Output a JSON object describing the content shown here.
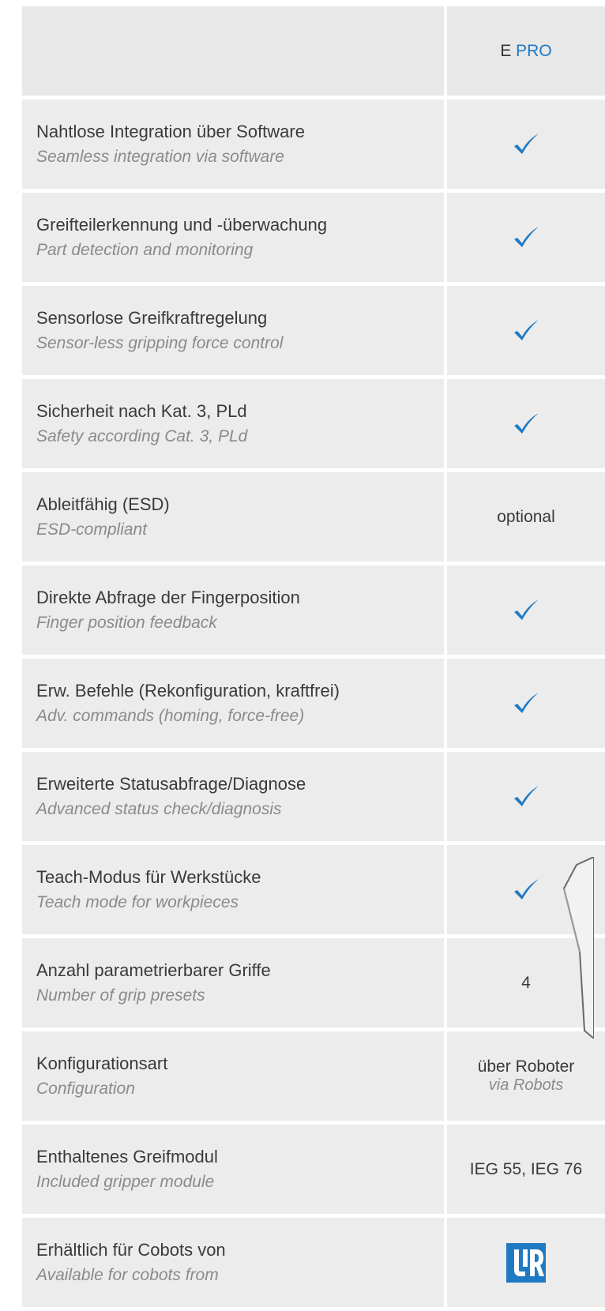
{
  "header": {
    "brand_e": "E",
    "brand_pro": "PRO"
  },
  "colors": {
    "accent": "#1f7ac4",
    "row_bg": "#ececec"
  },
  "rows": [
    {
      "de": "Nahtlose Integration über Software",
      "en": "Seamless integration via software",
      "value_type": "check"
    },
    {
      "de": "Greifteilerkennung und -überwachung",
      "en": "Part detection and monitoring",
      "value_type": "check"
    },
    {
      "de": "Sensorlose Greifkraftregelung",
      "en": "Sensor-less gripping force control",
      "value_type": "check"
    },
    {
      "de": "Sicherheit nach Kat. 3, PLd",
      "en": "Safety according Cat. 3, PLd",
      "value_type": "check"
    },
    {
      "de": "Ableitfähig (ESD)",
      "en": "ESD-compliant",
      "value_type": "text",
      "value": "optional"
    },
    {
      "de": "Direkte Abfrage der Fingerposition",
      "en": "Finger position feedback",
      "value_type": "check"
    },
    {
      "de": "Erw. Befehle (Rekonfiguration, kraftfrei)",
      "en": "Adv. commands (homing, force-free)",
      "value_type": "check"
    },
    {
      "de": "Erweiterte Statusabfrage/Diagnose",
      "en": "Advanced status check/diagnosis",
      "value_type": "check"
    },
    {
      "de": "Teach-Modus für Werkstücke",
      "en": "Teach mode for workpieces",
      "value_type": "check"
    },
    {
      "de": "Anzahl parametrierbarer Griffe",
      "en": "Number of grip presets",
      "value_type": "text",
      "value": "4"
    },
    {
      "de": "Konfigurationsart",
      "en": "Configuration",
      "value_type": "text",
      "value": "über Roboter",
      "value_en": "via Robots"
    },
    {
      "de": "Enthaltenes Greifmodul",
      "en": "Included gripper module",
      "value_type": "text",
      "value": "IEG 55, IEG 76"
    },
    {
      "de": "Erhältlich für Cobots von",
      "en": "Available for cobots from",
      "value_type": "logo",
      "icon": "universal-robots-logo-icon"
    }
  ]
}
